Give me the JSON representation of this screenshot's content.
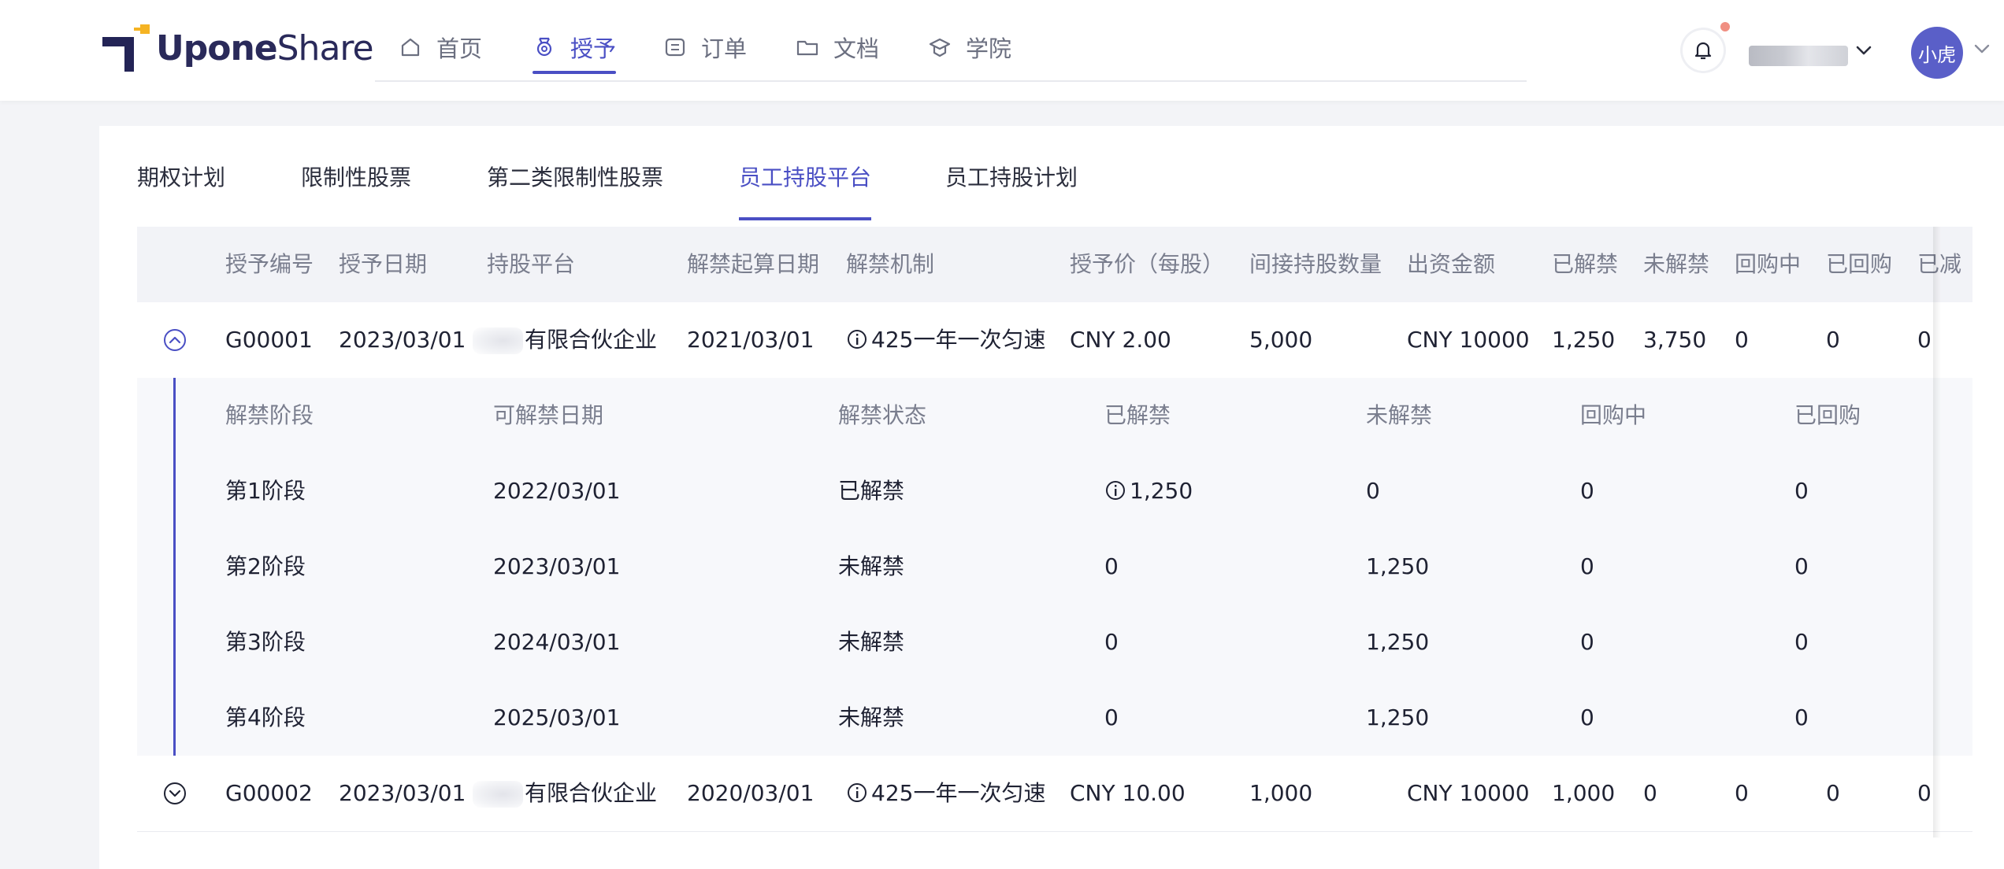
{
  "header": {
    "logo_bold": "Upone",
    "logo_light": "Share",
    "nav": [
      {
        "label": "首页",
        "icon": "home-icon"
      },
      {
        "label": "授予",
        "icon": "medal-icon"
      },
      {
        "label": "订单",
        "icon": "order-icon"
      },
      {
        "label": "文档",
        "icon": "folder-icon"
      },
      {
        "label": "学院",
        "icon": "graduation-cap-icon"
      }
    ],
    "active_nav": "授予",
    "avatar_text": "小虎",
    "brand_color": "#4a4fc4",
    "notification_dot_color": "#f08f82"
  },
  "tabs": [
    {
      "label": "期权计划"
    },
    {
      "label": "限制性股票"
    },
    {
      "label": "第二类限制性股票"
    },
    {
      "label": "员工持股平台"
    },
    {
      "label": "员工持股计划"
    }
  ],
  "active_tab": "员工持股平台",
  "table": {
    "columns": [
      "授予编号",
      "授予日期",
      "持股平台",
      "解禁起算日期",
      "解禁机制",
      "授予价（每股）",
      "间接持股数量",
      "出资金额",
      "已解禁",
      "未解禁",
      "回购中",
      "已回购",
      "已减"
    ],
    "rows": [
      {
        "expanded": true,
        "grant_no": "G00001",
        "grant_date": "2023/03/01",
        "platform": "有限合伙企业",
        "vest_start": "2021/03/01",
        "mechanism": "425一年一次匀速",
        "price": "CNY 2.00",
        "shares": "5,000",
        "amount": "CNY 10000",
        "vested": "1,250",
        "unvested": "3,750",
        "repurchasing": "0",
        "repurchased": "0",
        "reduced": "0"
      },
      {
        "expanded": false,
        "grant_no": "G00002",
        "grant_date": "2023/03/01",
        "platform": "有限合伙企业",
        "vest_start": "2020/03/01",
        "mechanism": "425一年一次匀速",
        "price": "CNY 10.00",
        "shares": "1,000",
        "amount": "CNY 10000",
        "vested": "1,000",
        "unvested": "0",
        "repurchasing": "0",
        "repurchased": "0",
        "reduced": "0"
      }
    ],
    "sub_columns": [
      "解禁阶段",
      "可解禁日期",
      "解禁状态",
      "已解禁",
      "未解禁",
      "回购中",
      "已回购"
    ],
    "sub_rows": [
      {
        "stage": "第1阶段",
        "date": "2022/03/01",
        "status": "已解禁",
        "vested": "1,250",
        "unvested": "0",
        "repurchasing": "0",
        "repurchased": "0"
      },
      {
        "stage": "第2阶段",
        "date": "2023/03/01",
        "status": "未解禁",
        "vested": "0",
        "unvested": "1,250",
        "repurchasing": "0",
        "repurchased": "0"
      },
      {
        "stage": "第3阶段",
        "date": "2024/03/01",
        "status": "未解禁",
        "vested": "0",
        "unvested": "1,250",
        "repurchasing": "0",
        "repurchased": "0"
      },
      {
        "stage": "第4阶段",
        "date": "2025/03/01",
        "status": "未解禁",
        "vested": "0",
        "unvested": "1,250",
        "repurchasing": "0",
        "repurchased": "0"
      }
    ]
  }
}
